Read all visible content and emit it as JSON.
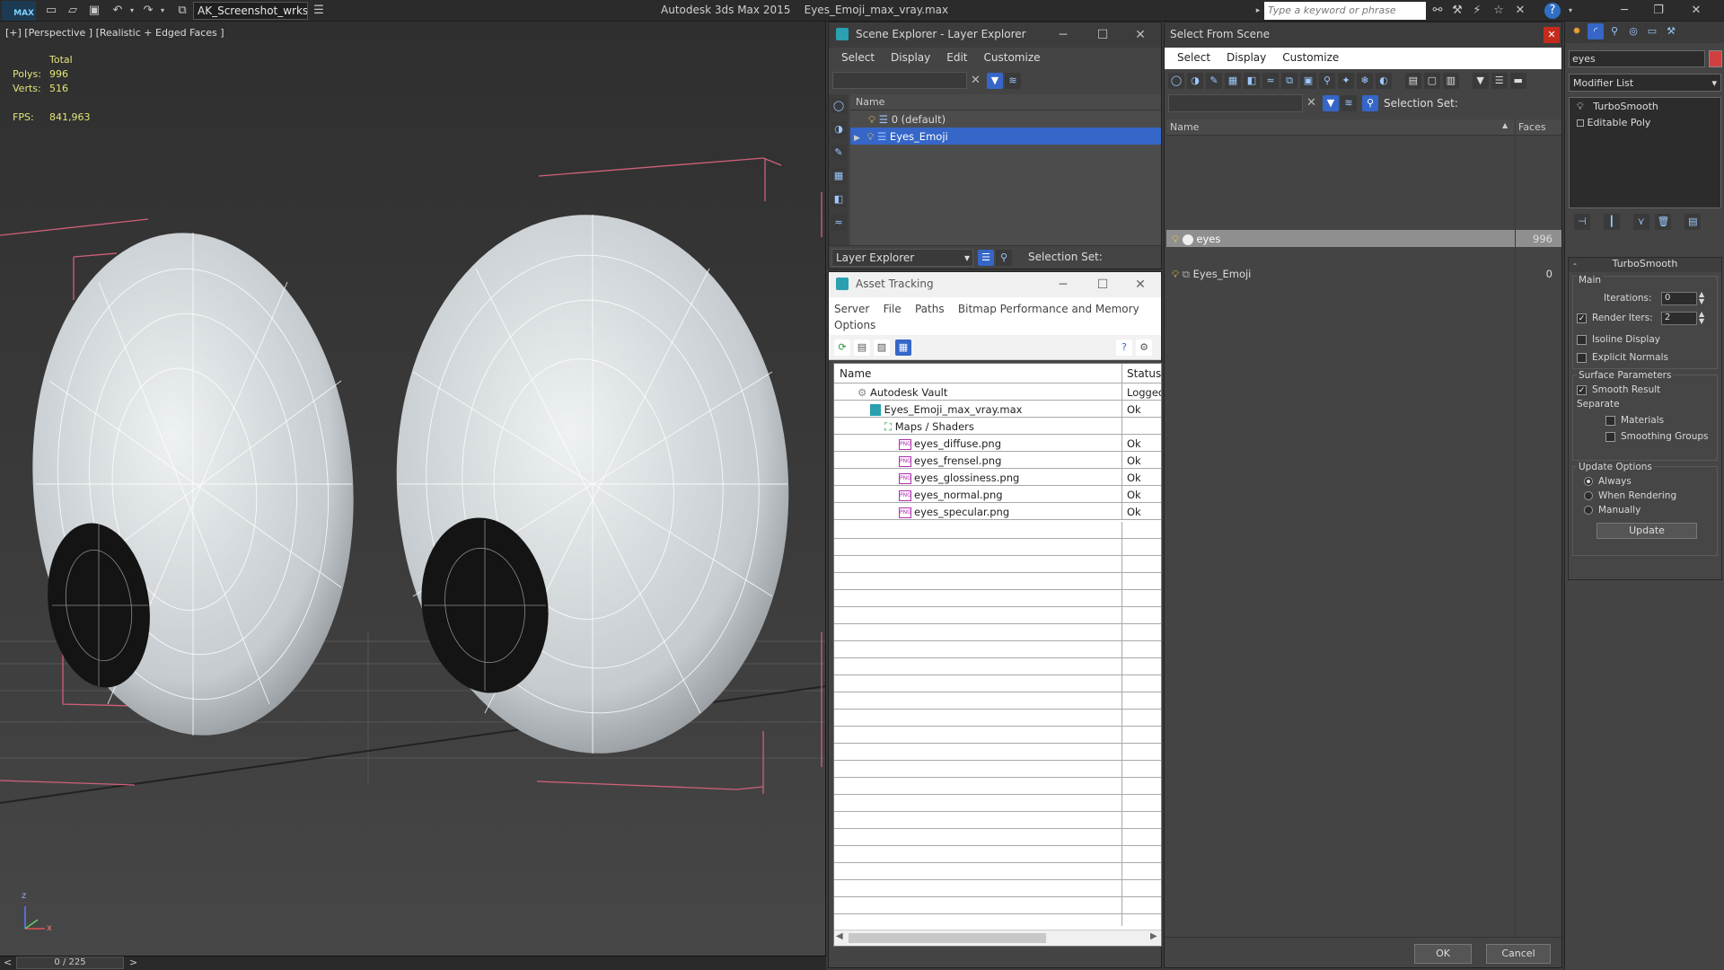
{
  "titlebar": {
    "app_logo": "MAX",
    "workspace": "AK_Screenshot_wrksp",
    "app_name": "Autodesk 3ds Max  2015",
    "file_name": "Eyes_Emoji_max_vray.max",
    "search_placeholder": "Type a keyword or phrase"
  },
  "viewport": {
    "label": "[+] [Perspective ] [Realistic + Edged Faces ]",
    "stats": {
      "total_label": "Total",
      "polys_label": "Polys:",
      "polys": "996",
      "verts_label": "Verts:",
      "verts": "516",
      "fps_label": "FPS:",
      "fps": "841,963"
    },
    "axis_z": "z",
    "axis_x": "x"
  },
  "timeline": {
    "position": "0 / 225",
    "prev": "<",
    "next": ">"
  },
  "scene_explorer": {
    "title": "Scene Explorer - Layer Explorer",
    "menu": [
      "Select",
      "Display",
      "Edit",
      "Customize"
    ],
    "column_name": "Name",
    "layers": [
      {
        "name": "0 (default)"
      },
      {
        "name": "Eyes_Emoji"
      }
    ],
    "footer_dropdown": "Layer Explorer",
    "selection_set_label": "Selection Set:"
  },
  "asset_tracking": {
    "title": "Asset Tracking",
    "menu": [
      "Server",
      "File",
      "Paths",
      "Bitmap Performance and Memory"
    ],
    "menu2": "Options",
    "col_name": "Name",
    "col_status": "Status",
    "rows": [
      {
        "name": "Autodesk Vault",
        "status": "Logged",
        "indent": 0
      },
      {
        "name": "Eyes_Emoji_max_vray.max",
        "status": "Ok",
        "indent": 1
      },
      {
        "name": "Maps / Shaders",
        "status": "",
        "indent": 2
      },
      {
        "name": "eyes_diffuse.png",
        "status": "Ok",
        "indent": 3
      },
      {
        "name": "eyes_frensel.png",
        "status": "Ok",
        "indent": 3
      },
      {
        "name": "eyes_glossiness.png",
        "status": "Ok",
        "indent": 3
      },
      {
        "name": "eyes_normal.png",
        "status": "Ok",
        "indent": 3
      },
      {
        "name": "eyes_specular.png",
        "status": "Ok",
        "indent": 3
      }
    ],
    "png_badge": "PNG"
  },
  "select_from_scene": {
    "title": "Select From Scene",
    "menu": [
      "Select",
      "Display",
      "Customize"
    ],
    "selection_set_label": "Selection Set:",
    "col_name": "Name",
    "col_faces": "Faces",
    "rows": [
      {
        "name": "eyes",
        "faces": "996"
      },
      {
        "name": "Eyes_Emoji",
        "faces": "0"
      }
    ],
    "ok": "OK",
    "cancel": "Cancel"
  },
  "modify_panel": {
    "object_name": "eyes",
    "modifier_list": "Modifier List",
    "stack": [
      "TurboSmooth",
      "Editable Poly"
    ],
    "rollout_title": "TurboSmooth",
    "main_label": "Main",
    "iterations_label": "Iterations:",
    "iterations": "0",
    "render_iters_label": "Render Iters:",
    "render_iters": "2",
    "isoline_display": "Isoline Display",
    "explicit_normals": "Explicit Normals",
    "surface_params": "Surface Parameters",
    "smooth_result": "Smooth Result",
    "separate": "Separate",
    "materials": "Materials",
    "smoothing_groups": "Smoothing Groups",
    "update_options": "Update Options",
    "always": "Always",
    "when_rendering": "When Rendering",
    "manually": "Manually",
    "update_button": "Update",
    "collapse": "-"
  },
  "colors": {
    "selection_blue": "#3566c8",
    "bbox_pink": "#d0607a",
    "stat_yellow": "#e3e37a",
    "close_red": "#c42b1c"
  }
}
